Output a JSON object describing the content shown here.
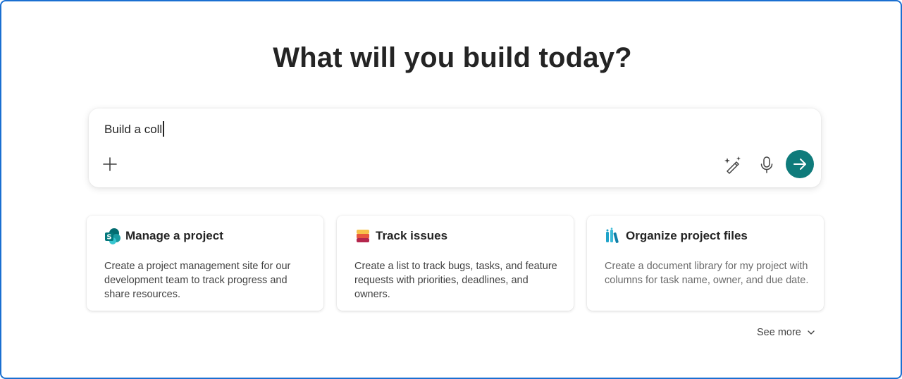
{
  "heading": "What will you build today?",
  "prompt": {
    "value": "Build a coll"
  },
  "toolbar": {
    "add_icon": "plus-icon",
    "enhance_icon": "magic-wand-icon",
    "mic_icon": "microphone-icon",
    "send_icon": "arrow-right-icon"
  },
  "cards": [
    {
      "title": "Manage a project",
      "description": "Create a project management site for our development team to track progress and share resources.",
      "icon": "sharepoint-icon"
    },
    {
      "title": "Track issues",
      "description": "Create a list to track bugs, tasks, and feature requests with priorities, deadlines, and owners.",
      "icon": "lists-icon"
    },
    {
      "title": "Organize project files",
      "description": "Create a document library for my project with columns for task name, owner, and due date.",
      "icon": "library-icon"
    }
  ],
  "see_more": "See more",
  "colors": {
    "accent": "#0f7b7b",
    "frame_border": "#1a6fd1",
    "text": "#242424"
  }
}
